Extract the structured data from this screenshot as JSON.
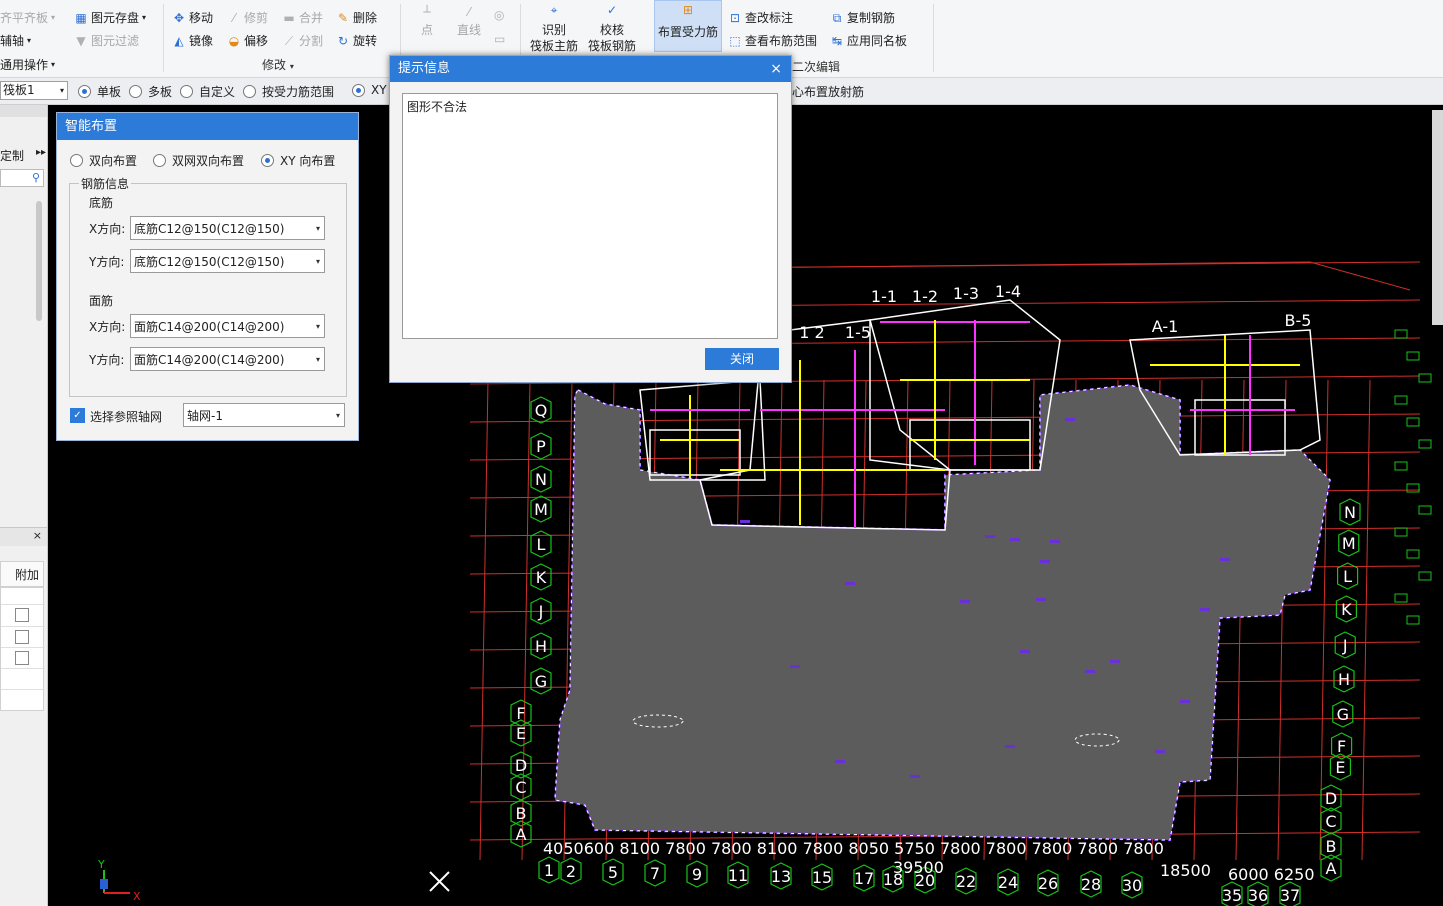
{
  "ribbon": {
    "left_items": {
      "align_slab": "齐平齐板",
      "element_save": "图元存盘",
      "aux_axis": "辅轴",
      "element_filter": "图元过滤",
      "common_ops": "通用操作"
    },
    "modify_items": {
      "move": "移动",
      "trim": "修剪",
      "merge": "合并",
      "delete": "删除",
      "mirror": "镜像",
      "offset": "偏移",
      "split": "分割",
      "rotate": "旋转"
    },
    "modify_group": "修改",
    "draw_items": {
      "point": "点",
      "line": "直线"
    },
    "rebar_btns": {
      "identify_top": "识别",
      "identify_bottom": "筏板主筋",
      "check_top": "校核",
      "check_bottom": "筏板钢筋",
      "layout": "布置受力筋"
    },
    "edit_items": {
      "view_mark": "查改标注",
      "view_range": "查看布筋范围",
      "copy_rebar": "复制钢筋",
      "apply_same": "应用同名板"
    },
    "secondary_edit": "二次编辑"
  },
  "optbar": {
    "combo_value": "筏板1",
    "options": [
      "单板",
      "多板",
      "自定义",
      "按受力筋范围",
      "XY"
    ],
    "selected": "单板",
    "extra": "心布置放射筋"
  },
  "left_panel": {
    "custom_label": "定制",
    "col_header": "附加"
  },
  "smart_dialog": {
    "title": "智能布置",
    "modes": [
      "双向布置",
      "双网双向布置",
      "XY 向布置"
    ],
    "selected_mode": "XY 向布置",
    "group_title": "钢筋信息",
    "bottom_title": "底筋",
    "top_title": "面筋",
    "x_label": "X方向:",
    "y_label": "Y方向:",
    "bottom_x": "底筋C12@150(C12@150)",
    "bottom_y": "底筋C12@150(C12@150)",
    "top_x": "面筋C14@200(C14@200)",
    "top_y": "面筋C14@200(C14@200)",
    "ref_grid_label": "选择参照轴网",
    "ref_grid_value": "轴网-1",
    "ref_grid_checked": true
  },
  "hint_dialog": {
    "title": "提示信息",
    "message": "图形不合法",
    "close_label": "关闭"
  },
  "canvas": {
    "left_axis_letters": [
      "Q",
      "P",
      "N",
      "M",
      "L",
      "K",
      "J",
      "H",
      "G",
      "F",
      "E",
      "D",
      "C",
      "B",
      "A"
    ],
    "right_axis_letters": [
      "N",
      "M",
      "L",
      "K",
      "J",
      "H",
      "G",
      "F",
      "E",
      "D",
      "C",
      "B",
      "A"
    ],
    "bottom_axis_numbers": [
      "1",
      "2",
      "5",
      "7",
      "9",
      "11",
      "13",
      "15",
      "17",
      "18",
      "20",
      "22",
      "24",
      "26",
      "28",
      "30",
      "35",
      "36",
      "37"
    ],
    "bottom_dims": "4050600 8100 7800 7800 8100 7800 8050 5750 7800 7800 7800 7800 7800",
    "dim_18500": "18500",
    "dim_right": "6000 6250",
    "dim_39500": "39500",
    "top_axis_labels": [
      "1-1",
      "1-2",
      "1-3",
      "1-4",
      "1 2",
      "1-5",
      "A-1",
      "B-5"
    ],
    "colors": {
      "slab_fill": "#5c5c5c",
      "grid_red": "#d0302c",
      "outline_white": "#ffffff",
      "rebar_yellow": "#ffff00",
      "rebar_magenta": "#ff33ff",
      "dashed_border": "#7a2fff",
      "axis_green": "#19c219"
    }
  }
}
